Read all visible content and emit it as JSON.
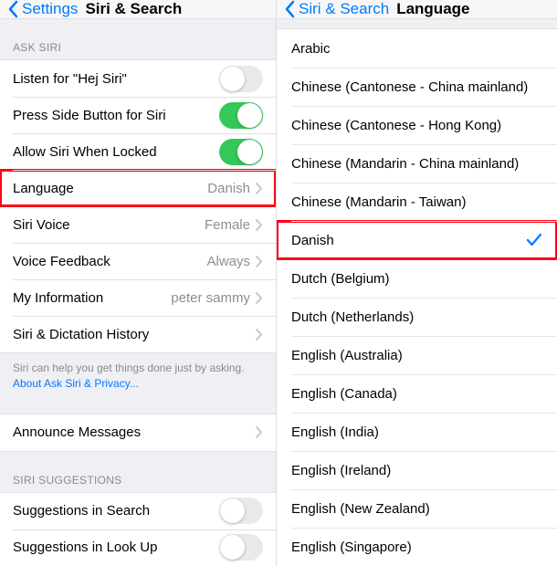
{
  "left": {
    "back": "Settings",
    "title": "Siri & Search",
    "askSiriHeader": "ASK SIRI",
    "rows": {
      "listen": {
        "label": "Listen for \"Hej Siri\"",
        "on": false
      },
      "sideButton": {
        "label": "Press Side Button for Siri",
        "on": true
      },
      "locked": {
        "label": "Allow Siri When Locked",
        "on": true
      },
      "language": {
        "label": "Language",
        "value": "Danish"
      },
      "voice": {
        "label": "Siri Voice",
        "value": "Female"
      },
      "feedback": {
        "label": "Voice Feedback",
        "value": "Always"
      },
      "myInfo": {
        "label": "My Information",
        "value": "peter sammy"
      },
      "history": {
        "label": "Siri & Dictation History"
      }
    },
    "footer": {
      "text": "Siri can help you get things done just by asking. ",
      "link": "About Ask Siri & Privacy..."
    },
    "announce": {
      "label": "Announce Messages"
    },
    "suggHeader": "SIRI SUGGESTIONS",
    "sugg": {
      "search": {
        "label": "Suggestions in Search",
        "on": false
      },
      "lookup": {
        "label": "Suggestions in Look Up",
        "on": false
      }
    }
  },
  "right": {
    "back": "Siri & Search",
    "title": "Language",
    "selected": "Danish",
    "items": [
      "Arabic",
      "Chinese (Cantonese - China mainland)",
      "Chinese (Cantonese - Hong Kong)",
      "Chinese (Mandarin - China mainland)",
      "Chinese (Mandarin - Taiwan)",
      "Danish",
      "Dutch (Belgium)",
      "Dutch (Netherlands)",
      "English (Australia)",
      "English (Canada)",
      "English (India)",
      "English (Ireland)",
      "English (New Zealand)",
      "English (Singapore)"
    ]
  }
}
